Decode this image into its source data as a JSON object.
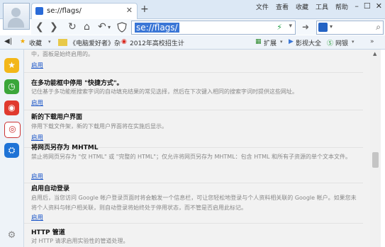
{
  "tab": {
    "title": "se://flags/",
    "close": "✕",
    "new": "+"
  },
  "menu": [
    "文件",
    "查看",
    "收藏",
    "工具",
    "帮助"
  ],
  "window_controls": [
    "–",
    "☐",
    "✕"
  ],
  "address": {
    "url": "se://flags/"
  },
  "bookmarks": [
    {
      "label": "收藏",
      "icon": "star-icon"
    },
    {
      "label": "《电脑爱好者》杂",
      "icon": "magazine-icon"
    },
    {
      "label": "2012年高校招生计",
      "icon": "weibo-icon"
    }
  ],
  "toolbar_right": {
    "extensions": "扩展",
    "video": "影视大全",
    "bank": "网银"
  },
  "features": [
    {
      "title": "",
      "desc": "中，面板是始终启用的。",
      "action": "启用"
    },
    {
      "title": "在多功能框中停用 \"快捷方式\"。",
      "desc": "记住基于多功能框搜索字词的自动填充结果的常见选择，然后在下次键入相同的搜索字词时提供这些网址。",
      "action": "启用"
    },
    {
      "title": "新的下载用户界面",
      "desc": "停用下载文件架，新的下载用户界面将在实施后显示。",
      "action": "启用"
    },
    {
      "title": "将网页另存为 MHTML",
      "desc": "禁止将网页另存为 \"仅 HTML\" 或 \"完整的 HTML\"；仅允许将网页另存为 MHTML：包含 HTML 和所有子资源的单个文本文件。",
      "action": "启用"
    },
    {
      "title": "启用自动登录",
      "desc": "启用后，当您访问 Google 帐户登录页面时将会触发一个信息栏，可让您轻松地登录与个人资料相关联的 Google 帐户。如果您未将个人资料与帐户相关联，则自动登录将始终处于停用状态，而不管是否启用此标记。",
      "action": "启用"
    },
    {
      "title": "HTTP 管道",
      "desc": "对 HTTP 请求启用实验性的管道处理。",
      "action": ""
    }
  ]
}
